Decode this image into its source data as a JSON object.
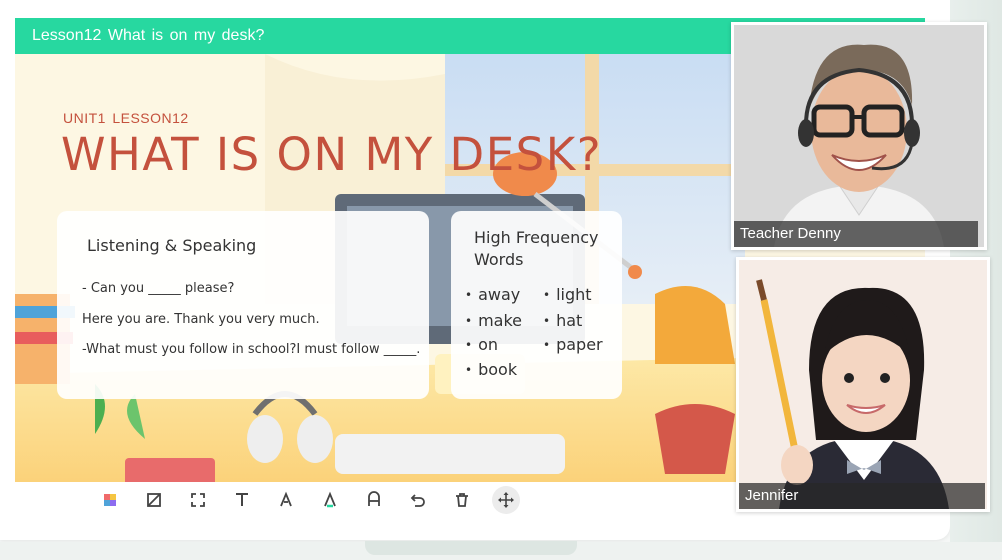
{
  "lesson_bar": {
    "title": "Lesson12  What is on my desk?"
  },
  "slide": {
    "subtitle": "UNIT1  LESSON12",
    "title": "WHAT IS ON MY DESK?"
  },
  "listening_card": {
    "heading": "Listening & Speaking",
    "lines": [
      "- Can you _____ please?",
      "Here you are. Thank you very much.",
      "-What must you follow in school?I must follow _____."
    ]
  },
  "words_card": {
    "heading_line1": "High Frequency",
    "heading_line2": "Words",
    "words": [
      "away",
      "make",
      "on",
      "book",
      "light",
      "hat",
      "paper"
    ]
  },
  "toolbar": {
    "tools": [
      "color-palette-icon",
      "crop-icon",
      "select-icon",
      "text-icon",
      "pen-icon",
      "highlighter-icon",
      "eraser-icon",
      "undo-icon",
      "delete-icon",
      "move-icon"
    ],
    "active_tool": "move-icon"
  },
  "videos": {
    "teacher_name": "Teacher Denny",
    "student_name": "Jennifer"
  },
  "colors": {
    "title_bar": "#27d8a0",
    "title_text": "#c4513d",
    "card_bg": "#ffffff"
  }
}
